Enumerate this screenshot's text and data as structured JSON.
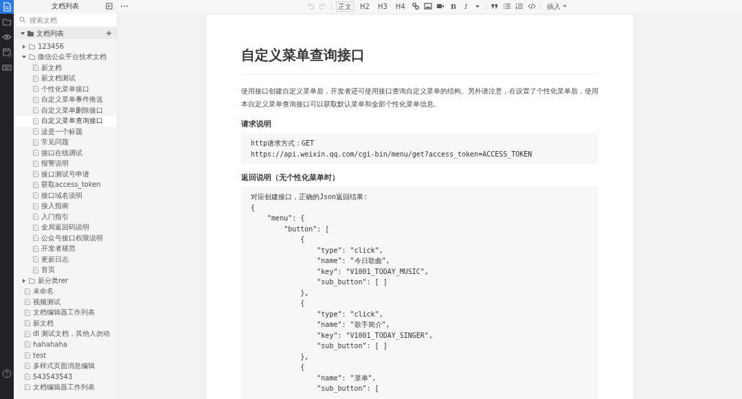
{
  "nav": [
    {
      "kind": "document",
      "selected": true
    },
    {
      "kind": "folder",
      "selected": false
    },
    {
      "kind": "eye",
      "selected": false
    },
    {
      "kind": "save",
      "selected": false
    },
    {
      "kind": "keyboard",
      "selected": false
    },
    {
      "kind": "help",
      "selected": false
    }
  ],
  "sidebar": {
    "title": "文档列表",
    "search": {
      "placeholder": "搜索文档"
    },
    "tree": {
      "label": "文档列表",
      "expanded": true,
      "children": [
        {
          "kind": "folder",
          "label": "123456",
          "expanded": false,
          "selected": false
        },
        {
          "kind": "folder",
          "label": "微信公众平台技术文档",
          "expanded": true,
          "selected": false,
          "children": [
            {
              "kind": "doc",
              "label": "新文档",
              "selected": false
            },
            {
              "kind": "doc",
              "label": "新文档测试",
              "selected": false
            },
            {
              "kind": "doc",
              "label": "个性化菜单接口",
              "selected": false
            },
            {
              "kind": "doc",
              "label": "自定义菜单事件推送",
              "selected": false
            },
            {
              "kind": "doc",
              "label": "自定义菜单删除接口",
              "selected": false
            },
            {
              "kind": "doc",
              "label": "自定义菜单查询接口",
              "selected": true
            },
            {
              "kind": "doc",
              "label": "这是一个标题",
              "selected": false
            },
            {
              "kind": "doc",
              "label": "常见问题",
              "selected": false
            },
            {
              "kind": "doc",
              "label": "接口在线调试",
              "selected": false
            },
            {
              "kind": "doc",
              "label": "报警说明",
              "selected": false
            },
            {
              "kind": "doc",
              "label": "接口测试号申请",
              "selected": false
            },
            {
              "kind": "doc",
              "label": "获取access_token",
              "selected": false
            },
            {
              "kind": "doc",
              "label": "接口域名说明",
              "selected": false
            },
            {
              "kind": "doc",
              "label": "接入指南",
              "selected": false
            },
            {
              "kind": "doc",
              "label": "入门指引",
              "selected": false
            },
            {
              "kind": "doc",
              "label": "全局返回码说明",
              "selected": false
            },
            {
              "kind": "doc",
              "label": "公众号接口权限说明",
              "selected": false
            },
            {
              "kind": "doc",
              "label": "开发者规范",
              "selected": false
            },
            {
              "kind": "doc",
              "label": "更新日志",
              "selected": false
            },
            {
              "kind": "doc",
              "label": "首页",
              "selected": false
            }
          ]
        },
        {
          "kind": "folder",
          "label": "新分类rer",
          "expanded": false,
          "selected": false
        },
        {
          "kind": "doc",
          "label": "未命名",
          "selected": false
        },
        {
          "kind": "doc",
          "label": "视频测试",
          "selected": false
        },
        {
          "kind": "doc",
          "label": "文档编辑器工作列表",
          "selected": false
        },
        {
          "kind": "doc",
          "label": "新文档",
          "selected": false
        },
        {
          "kind": "doc",
          "label": "dl 测试文档，其他人勿动",
          "selected": false
        },
        {
          "kind": "doc",
          "label": "hahahaha",
          "selected": false
        },
        {
          "kind": "doc",
          "label": "test",
          "selected": false
        },
        {
          "kind": "doc",
          "label": "多样式页面消息编辑",
          "selected": false
        },
        {
          "kind": "doc",
          "label": "543543543",
          "selected": false
        },
        {
          "kind": "doc",
          "label": "文档编辑器工作列表",
          "selected": false
        }
      ]
    }
  },
  "toolbar": [
    {
      "kind": "undo",
      "disabled": true
    },
    {
      "kind": "redo",
      "disabled": true
    },
    {
      "kind": "separator"
    },
    {
      "kind": "style",
      "label": "正文",
      "selected": true
    },
    {
      "kind": "style",
      "label": "H2",
      "selected": false
    },
    {
      "kind": "style",
      "label": "H3",
      "selected": false
    },
    {
      "kind": "style",
      "label": "H4",
      "selected": false
    },
    {
      "kind": "link"
    },
    {
      "kind": "image"
    },
    {
      "kind": "video"
    },
    {
      "kind": "bold",
      "label": "B"
    },
    {
      "kind": "italic",
      "label": "I"
    },
    {
      "kind": "caret"
    },
    {
      "kind": "separator"
    },
    {
      "kind": "quote"
    },
    {
      "kind": "bullet-list"
    },
    {
      "kind": "numbered-list"
    },
    {
      "kind": "code"
    },
    {
      "kind": "separator"
    },
    {
      "kind": "menu",
      "label": "插入"
    }
  ],
  "document": {
    "title": "自定义菜单查询接口",
    "blocks": [
      {
        "kind": "paragraph",
        "text": "使用接口创建自定义菜单后，开发者还可使用接口查询自定义菜单的结构。另外请注意，在设置了个性化菜单后，使用本自定义菜单查询接口可以获取默认菜单和全部个性化菜单信息。"
      },
      {
        "kind": "heading",
        "text": "请求说明"
      },
      {
        "kind": "code",
        "lines": [
          "http请求方式：GET",
          "https://api.weixin.qq.com/cgi-bin/menu/get?access_token=ACCESS_TOKEN"
        ]
      },
      {
        "kind": "heading",
        "text": "返回说明（无个性化菜单时）"
      },
      {
        "kind": "code",
        "lines": [
          "对应创建接口，正确的Json返回结果:",
          "{",
          "    \"menu\": {",
          "        \"button\": [",
          "            {",
          "                \"type\": \"click\",",
          "                \"name\": \"今日歌曲\",",
          "                \"key\": \"V1001_TODAY_MUSIC\",",
          "                \"sub_button\": [ ]",
          "            },",
          "            {",
          "                \"type\": \"click\",",
          "                \"name\": \"歌手简介\",",
          "                \"key\": \"V1001_TODAY_SINGER\",",
          "                \"sub_button\": [ ]",
          "            },",
          "            {",
          "                \"name\": \"菜单\",",
          "                \"sub_button\": ["
        ]
      }
    ]
  }
}
